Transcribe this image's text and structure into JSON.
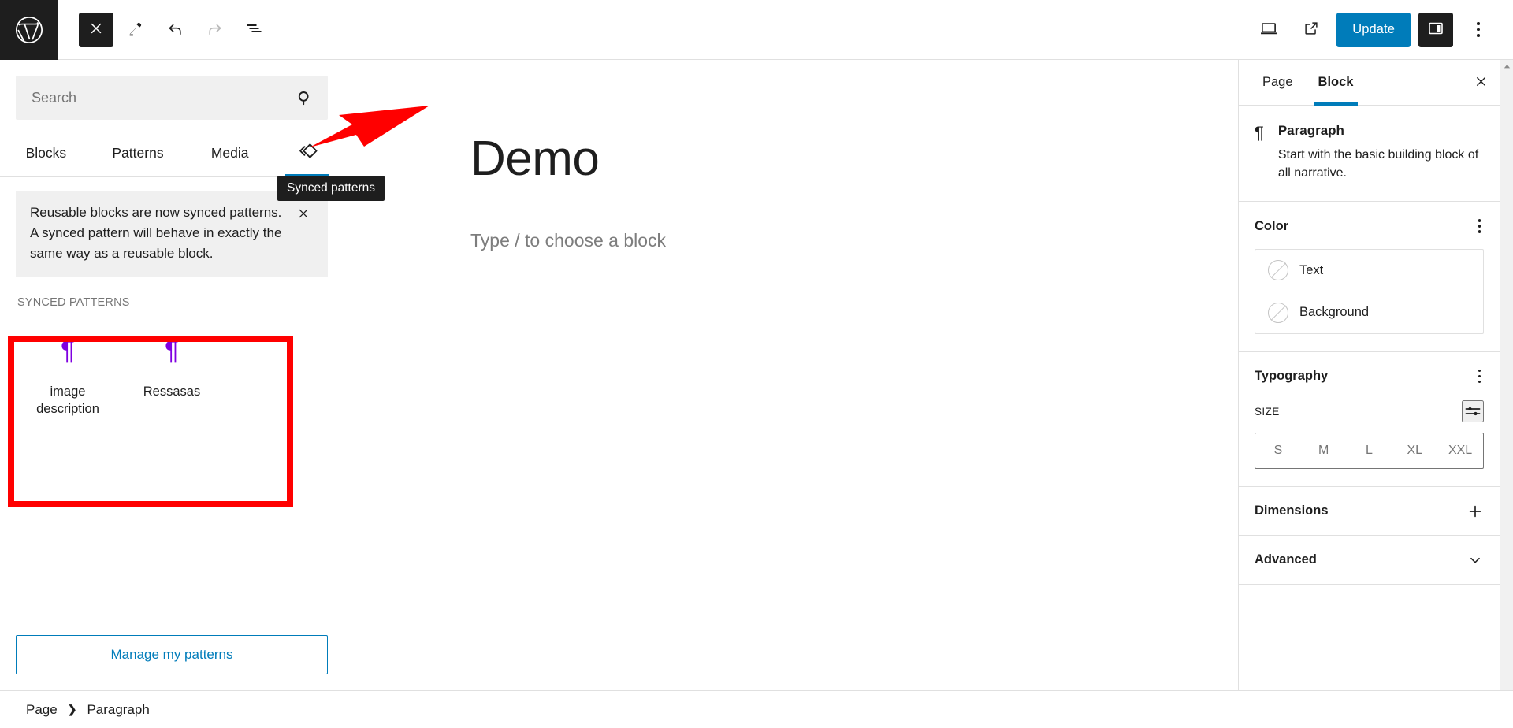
{
  "topbar": {
    "logo_icon": "wordpress-logo-icon",
    "close_icon": "close-icon",
    "edit_icon": "pencil-edit-icon",
    "undo_icon": "undo-icon",
    "redo_icon": "redo-icon",
    "list_view_icon": "document-overview-icon",
    "preview_icon": "desktop-preview-icon",
    "view_external_icon": "view-external-link-icon",
    "update_label": "Update",
    "settings_panel_icon": "settings-sidebar-icon",
    "options_icon": "more-options-kebab-icon"
  },
  "inserter": {
    "search": {
      "placeholder": "Search",
      "value": "",
      "icon": "search-icon"
    },
    "tabs": [
      {
        "label": "Blocks",
        "active": false
      },
      {
        "label": "Patterns",
        "active": false
      },
      {
        "label": "Media",
        "active": false
      }
    ],
    "synced_tab": {
      "icon": "synced-patterns-icon",
      "active": true,
      "tooltip": "Synced patterns"
    },
    "notice": {
      "text": "Reusable blocks are now synced patterns. A synced pattern will behave in exactly the same way as a reusable block.",
      "close_icon": "close-icon"
    },
    "section_title": "SYNCED PATTERNS",
    "patterns": [
      {
        "label": "image description",
        "glyph": "¶"
      },
      {
        "label": "Ressasas",
        "glyph": "¶"
      }
    ],
    "manage_label": "Manage my patterns"
  },
  "canvas": {
    "title": "Demo",
    "body_placeholder": "Type / to choose a block"
  },
  "settings": {
    "tabs": [
      {
        "label": "Page",
        "active": false
      },
      {
        "label": "Block",
        "active": true
      }
    ],
    "close_icon": "close-icon",
    "block": {
      "icon": "paragraph-icon",
      "glyph": "¶",
      "title": "Paragraph",
      "description": "Start with the basic building block of all narrative."
    },
    "color_panel": {
      "title": "Color",
      "options_icon": "more-options-kebab-icon",
      "rows": [
        {
          "label": "Text",
          "swatch": "none"
        },
        {
          "label": "Background",
          "swatch": "none"
        }
      ]
    },
    "typography_panel": {
      "title": "Typography",
      "options_icon": "more-options-kebab-icon",
      "size_label": "SIZE",
      "sliders_icon": "custom-size-sliders-icon",
      "sizes": [
        "S",
        "M",
        "L",
        "XL",
        "XXL"
      ],
      "selected_size": ""
    },
    "dimensions_panel": {
      "title": "Dimensions",
      "icon": "plus-icon"
    },
    "advanced_panel": {
      "title": "Advanced",
      "icon": "chevron-down-icon"
    },
    "scroll_up_icon": "scroll-up-arrow-icon"
  },
  "breadcrumb": {
    "items": [
      "Page",
      "Paragraph"
    ],
    "separator": "❯"
  },
  "annotations": {
    "arrow_color": "#ff0000",
    "box_color": "#ff0000"
  },
  "colors": {
    "accent": "#007cba",
    "dark": "#1e1e1e",
    "pattern_glyph": "#7f00e0",
    "annotation": "#ff0000"
  }
}
